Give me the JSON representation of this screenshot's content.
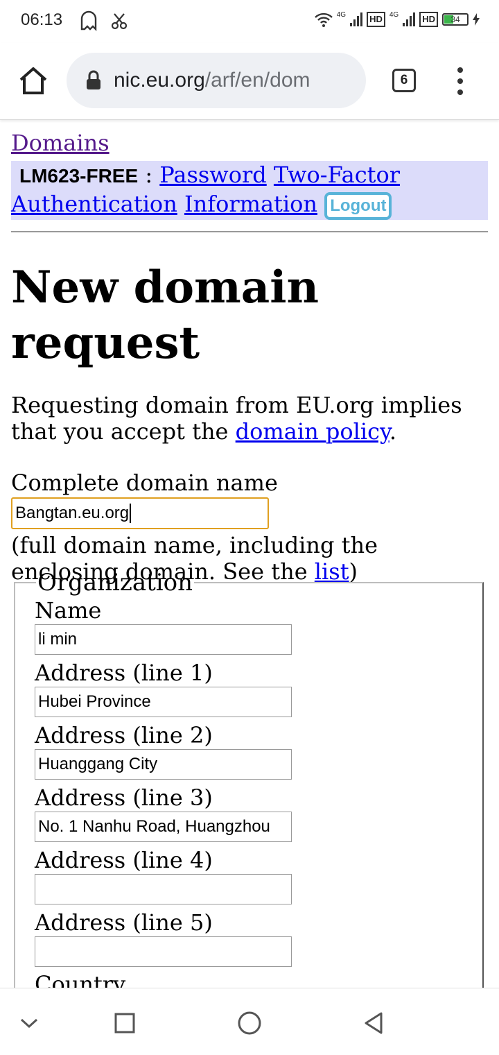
{
  "status_bar": {
    "time": "06:13",
    "network_1": "4G",
    "hd_1": "HD",
    "network_2": "4G",
    "hd_2": "HD",
    "battery_percent": "34",
    "icons": [
      "ghost-icon",
      "scissors-icon",
      "wifi-icon",
      "signal-icon",
      "signal-icon",
      "battery-icon",
      "charging-icon"
    ]
  },
  "browser": {
    "url_host": "nic.eu.org",
    "url_path": "/arf/en/dom",
    "tab_count": "6",
    "icons": [
      "home-icon",
      "lock-icon",
      "tabs-icon",
      "overflow-menu-icon"
    ]
  },
  "nav": {
    "domains_link": "Domains",
    "user_handle": "LM623-FREE",
    "separator": " : ",
    "password_link": "Password",
    "twofa_link": "Two-Factor Authentication",
    "information_link": "Information",
    "logout_button": "Logout"
  },
  "page": {
    "title": "New domain request",
    "intro_text": "Requesting domain from EU.org implies that you accept the ",
    "policy_link": "domain policy",
    "intro_end": ".",
    "domain_label": "Complete domain name",
    "domain_value": "Bangtan.eu.org",
    "hint_text": "(full domain name, including the enclosing domain. See the ",
    "list_link": "list",
    "hint_end": ")"
  },
  "organization": {
    "legend": "Organization",
    "fields": [
      {
        "label": "Name",
        "value": "li min"
      },
      {
        "label": "Address (line 1)",
        "value": "Hubei Province"
      },
      {
        "label": "Address (line 2)",
        "value": "Huanggang City"
      },
      {
        "label": "Address (line 3)",
        "value": "No. 1 Nanhu Road, Huangzhou"
      },
      {
        "label": "Address (line 4)",
        "value": ""
      },
      {
        "label": "Address (line 5)",
        "value": ""
      }
    ],
    "next_label": "Country"
  },
  "navbar": {
    "icons": [
      "chevron-down-icon",
      "square-icon",
      "circle-icon",
      "back-triangle-icon"
    ]
  }
}
